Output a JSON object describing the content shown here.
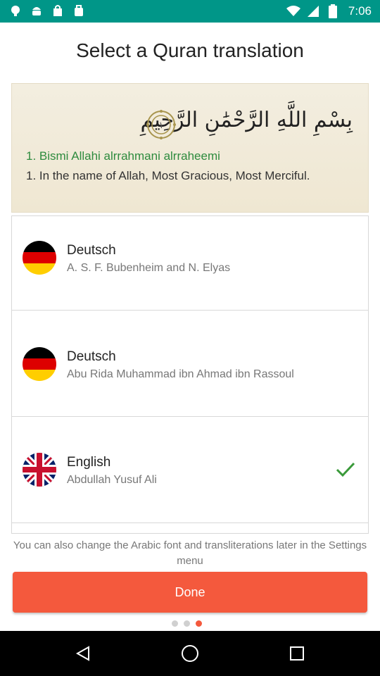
{
  "status_bar": {
    "time": "7:06",
    "icons": [
      "app-icon",
      "android-icon",
      "bag-icon",
      "shopping-icon",
      "wifi-icon",
      "signal-icon",
      "battery-icon"
    ]
  },
  "page_title": "Select a Quran translation",
  "preview": {
    "arabic": "بِسْمِ اللَّهِ الرَّحْمَٰنِ الرَّحِيمِ",
    "ayah_number": "١",
    "transliteration": "1. Bismi Allahi alrrahmani alrraheemi",
    "translation": "1. In the name of Allah, Most Gracious, Most Merciful."
  },
  "translations": [
    {
      "language": "Deutsch",
      "translator": "A. S. F. Bubenheim and N. Elyas",
      "flag": "germany-flag",
      "selected": false
    },
    {
      "language": "Deutsch",
      "translator": "Abu Rida Muhammad ibn Ahmad ibn Rassoul",
      "flag": "germany-flag",
      "selected": false
    },
    {
      "language": "English",
      "translator": "Abdullah Yusuf Ali",
      "flag": "uk-flag",
      "selected": true
    }
  ],
  "note": "You can also change the Arabic font and transliterations later in the Settings menu",
  "done_label": "Done",
  "pager": {
    "total": 3,
    "current": 3
  },
  "colors": {
    "accent": "#f4593d",
    "status_bar": "#009688",
    "check": "#3a9a3a",
    "transliteration": "#2e8b3e"
  }
}
